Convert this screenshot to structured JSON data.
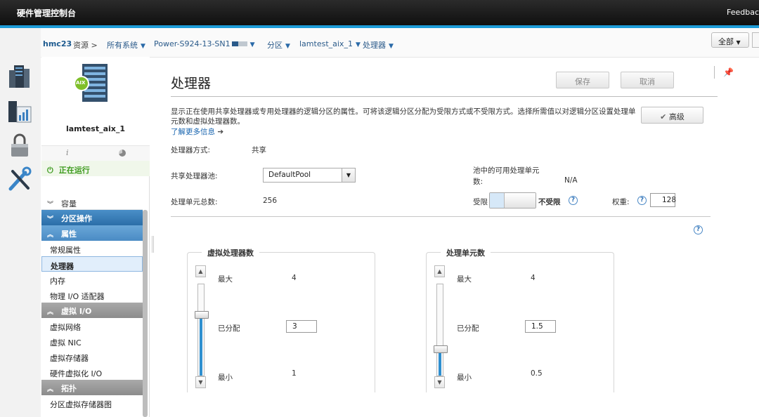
{
  "topbar": {
    "title": "硬件管理控制台",
    "feedback": "Feedbac"
  },
  "breadcrumb": {
    "host": "hmc23",
    "resources": "资源 >",
    "all_systems": "所有系统",
    "system": "Power-S924-13-SN1",
    "partitions": "分区",
    "lpar": "lamtest_aix_1",
    "processor": "处理器",
    "scope_select": "全部"
  },
  "lpar": {
    "name": "lamtest_aix_1",
    "os_badge": "AIX",
    "status": "正在运行"
  },
  "nav": {
    "capacity": "容量",
    "partition_actions": "分区操作",
    "properties_header": "属性",
    "general": "常规属性",
    "processor": "处理器",
    "memory": "内存",
    "physical_io": "物理 I/O 适配器",
    "virtual_io_header": "虚拟 I/O",
    "virtual_network": "虚拟网络",
    "virtual_nic": "虚拟 NIC",
    "virtual_storage": "虚拟存储器",
    "hw_virt_io": "硬件虚拟化 I/O",
    "topology_header": "拓扑",
    "storage_diagram": "分区虚拟存储器图"
  },
  "page": {
    "title": "处理器",
    "save": "保存",
    "cancel": "取消",
    "advanced": "高级",
    "description": "显示正在使用共享处理器或专用处理器的逻辑分区的属性。可将该逻辑分区分配为受限方式或不受限方式。选择所需值以对逻辑分区设置处理单元数和虚拟处理器数。",
    "learn_more": "了解更多信息"
  },
  "settings": {
    "mode_label": "处理器方式:",
    "mode_value": "共享",
    "pool_label": "共享处理器池:",
    "pool_value": "DefaultPool",
    "available_label_1": "池中的可用处理单元",
    "available_label_2": "数:",
    "available_value": "N/A",
    "total_label": "处理单元总数:",
    "total_value": "256",
    "capped_label": "受限",
    "uncapped_label": "不受限",
    "weight_label": "权重:",
    "weight_value": "128"
  },
  "virtual_processors": {
    "title": "虚拟处理器数",
    "max_label": "最大",
    "max_value": "4",
    "assigned_label": "已分配",
    "assigned_value": "3",
    "min_label": "最小",
    "min_value": "1",
    "slider_fraction": 0.67
  },
  "processing_units": {
    "title": "处理单元数",
    "max_label": "最大",
    "max_value": "4",
    "assigned_label": "已分配",
    "assigned_value": "1.5",
    "min_label": "最小",
    "min_value": "0.5",
    "slider_fraction": 0.29
  },
  "colors": {
    "accent": "#1d9bd7",
    "running": "#3c9a1c",
    "nav_header": "#2b6ea8",
    "link": "#1a66b0"
  }
}
